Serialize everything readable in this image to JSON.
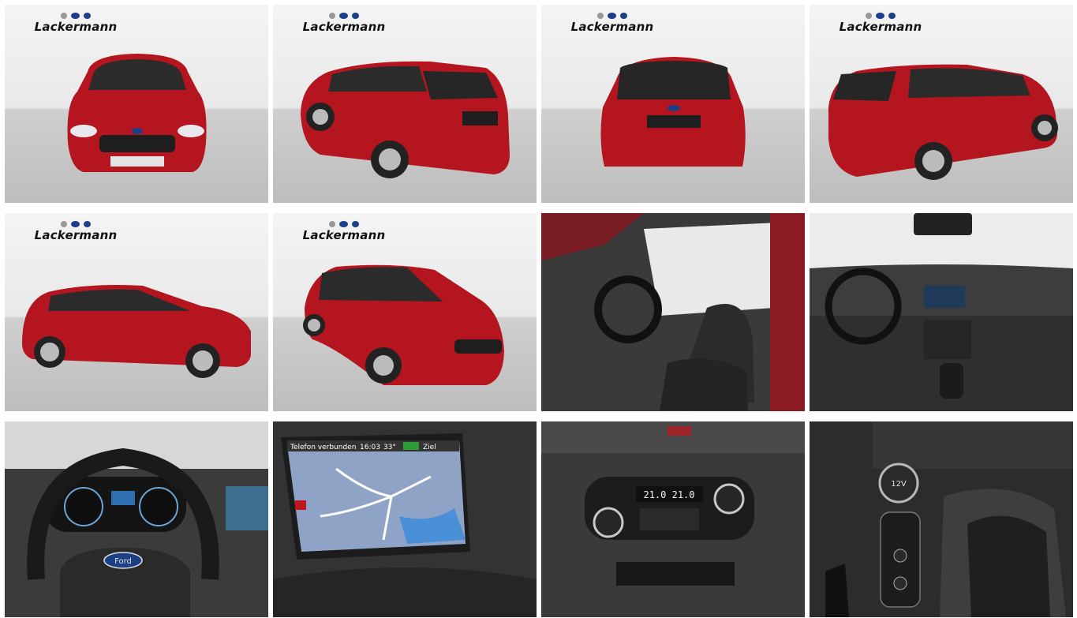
{
  "gallery": {
    "dealer_logo_text": "Lackermann",
    "accent_color": "#c0141e",
    "tiles": [
      {
        "view": "front",
        "icon": "car-front-icon"
      },
      {
        "view": "rear-left",
        "icon": "car-rear-icon"
      },
      {
        "view": "rear",
        "icon": "car-rear-icon"
      },
      {
        "view": "rear-right",
        "icon": "car-rear-icon"
      },
      {
        "view": "side-left",
        "icon": "car-side-icon"
      },
      {
        "view": "front-right",
        "icon": "car-front-icon"
      },
      {
        "view": "interior-driver-seat",
        "icon": "seat-icon"
      },
      {
        "view": "dashboard",
        "icon": "dashboard-icon"
      },
      {
        "view": "steering-wheel",
        "icon": "steering-wheel-icon"
      },
      {
        "view": "navigation-screen",
        "icon": "map-icon"
      },
      {
        "view": "climate-control",
        "icon": "climate-icon"
      },
      {
        "view": "gear-shifter",
        "icon": "gear-shift-icon"
      }
    ],
    "nav_screen": {
      "status_text": "Telefon verbunden",
      "time": "16:03",
      "temperature": "33°",
      "button_label": "Ziel"
    },
    "steering_badge": "Ford",
    "climate_display": "21.0  21.0",
    "socket_label": "12V"
  }
}
